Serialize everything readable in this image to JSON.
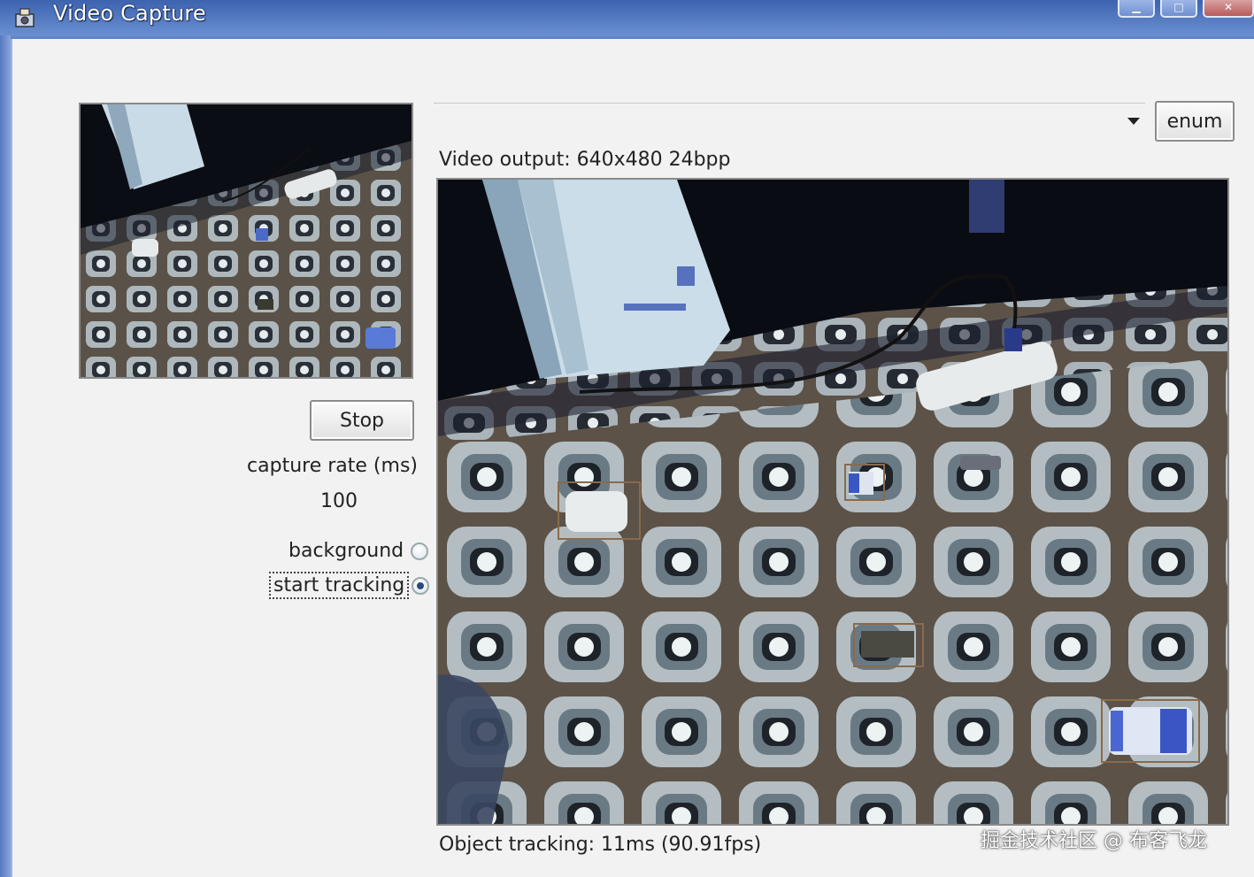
{
  "window": {
    "title": "Video Capture"
  },
  "left_panel": {
    "stop_label": "Stop",
    "capture_rate_label": "capture rate (ms)",
    "capture_rate_value": "100",
    "radios": [
      {
        "label": "background",
        "checked": false
      },
      {
        "label": "start tracking",
        "checked": true
      }
    ]
  },
  "right_panel": {
    "device_select_value": "",
    "enum_label": "enum",
    "video_output_label": "Video output: 640x480 24bpp",
    "tracking_status": "Object tracking: 11ms (90.91fps)"
  },
  "watermark": "掘金技术社区 @ 布客飞龙",
  "colors": {
    "titlebar": "#4a70b8",
    "client_bg": "#f2f2f2",
    "tracking_box": "#8a6a4a"
  }
}
